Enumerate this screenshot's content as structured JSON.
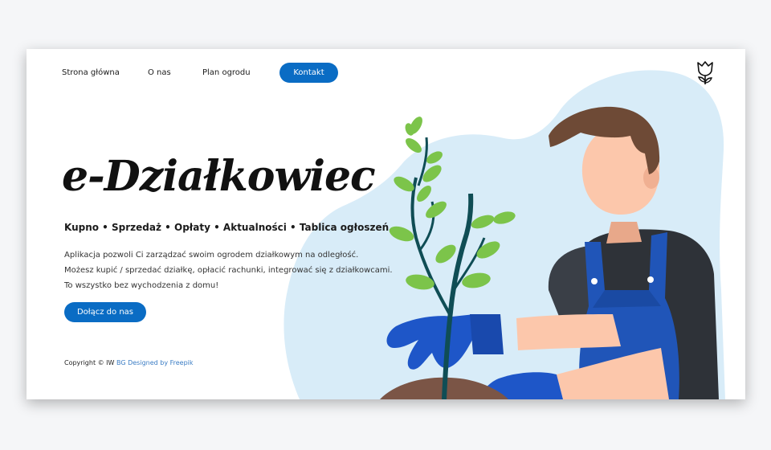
{
  "nav": {
    "home": "Strona główna",
    "about": "O nas",
    "plan": "Plan ogrodu",
    "contact": "Kontakt"
  },
  "hero": {
    "title": "e-Działkowiec",
    "features": "Kupno • Sprzedaż • Opłaty • Aktualności • Tablica ogłoszeń",
    "description": [
      "Aplikacja pozwoli Ci zarządzać swoim ogrodem działkowym na odległość.",
      "Możesz kupić / sprzedać działkę, opłacić rachunki, integrować się z działkowcami.",
      "To wszystko bez wychodzenia z domu!"
    ],
    "cta": "Dołącz do nas"
  },
  "footer": {
    "copyright": "Copyright © IW",
    "credit": "BG Designed by Freepik"
  },
  "colors": {
    "accent": "#0a6cc4",
    "blob": "#d8ecf8",
    "background": "#f5f6f8"
  },
  "icons": {
    "logo": "tulip-icon"
  }
}
